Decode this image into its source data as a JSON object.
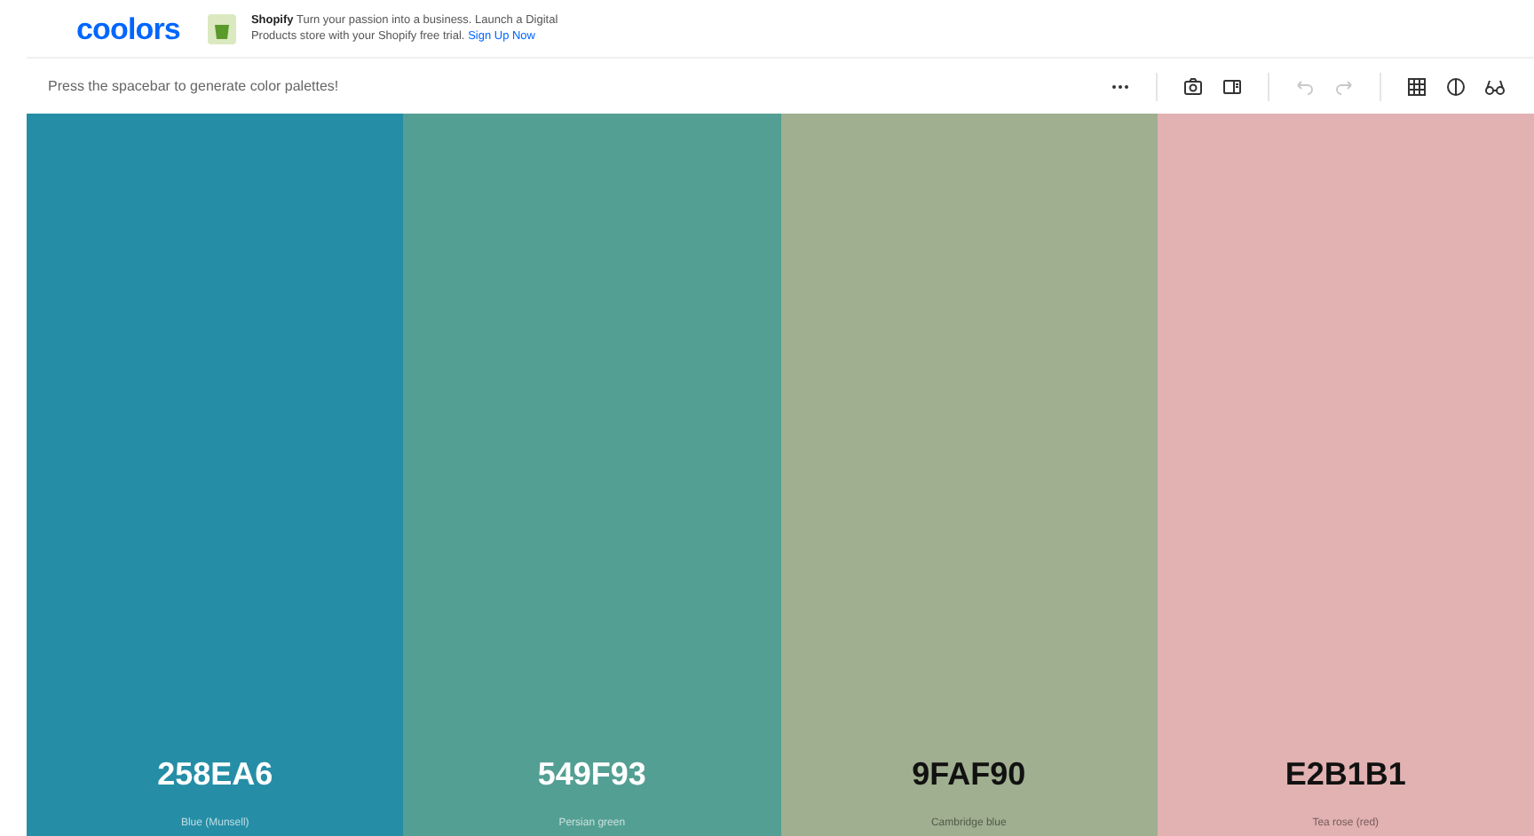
{
  "header": {
    "logo": "coolors",
    "ad": {
      "brand": "Shopify",
      "text": "Turn your passion into a business. Launch a Digital Products store with your Shopify free trial.",
      "link": "Sign Up Now"
    }
  },
  "toolbar": {
    "hint": "Press the spacebar to generate color palettes!",
    "tools": [
      {
        "kind": "more",
        "disabled": false
      },
      {
        "kind": "divider",
        "disabled": false
      },
      {
        "kind": "camera",
        "disabled": false
      },
      {
        "kind": "panel",
        "disabled": false
      },
      {
        "kind": "divider",
        "disabled": false
      },
      {
        "kind": "undo",
        "disabled": true
      },
      {
        "kind": "redo",
        "disabled": true
      },
      {
        "kind": "divider",
        "disabled": false
      },
      {
        "kind": "grid",
        "disabled": false
      },
      {
        "kind": "contrast",
        "disabled": false
      },
      {
        "kind": "glasses",
        "disabled": false
      }
    ]
  },
  "palette": [
    {
      "hex": "258EA6",
      "name": "Blue (Munsell)",
      "color": "#258ea6"
    },
    {
      "hex": "549F93",
      "name": "Persian green",
      "color": "#549f93"
    },
    {
      "hex": "9FAF90",
      "name": "Cambridge blue",
      "color": "#9faf90"
    },
    {
      "hex": "E2B1B1",
      "name": "Tea rose (red)",
      "color": "#e2b1b1"
    }
  ]
}
